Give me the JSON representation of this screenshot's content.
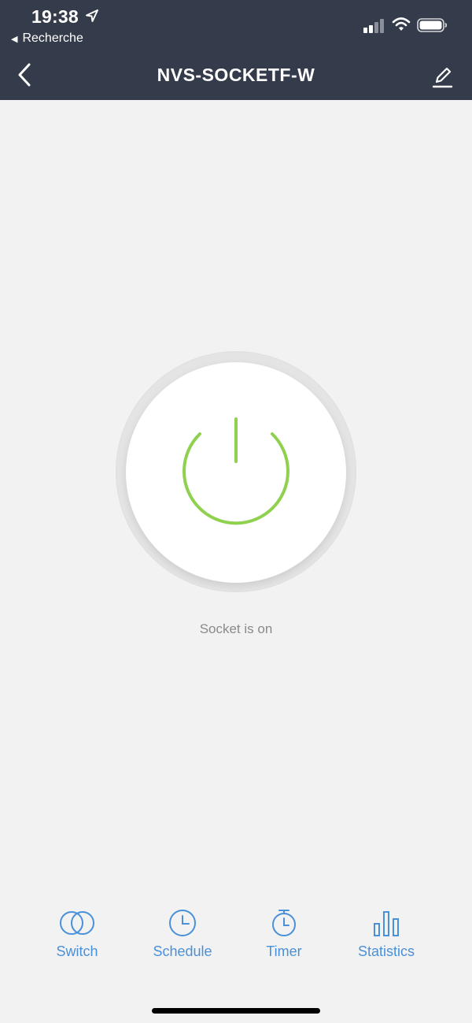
{
  "status_bar": {
    "time": "19:38",
    "back_app_label": "Recherche"
  },
  "nav": {
    "title": "NVS-SOCKETF-W"
  },
  "power": {
    "state": "on",
    "status_text": "Socket is on",
    "accent_color": "#8fd14f"
  },
  "tabs": [
    {
      "label": "Switch",
      "icon": "switch-icon"
    },
    {
      "label": "Schedule",
      "icon": "clock-icon"
    },
    {
      "label": "Timer",
      "icon": "stopwatch-icon"
    },
    {
      "label": "Statistics",
      "icon": "bar-chart-icon"
    }
  ],
  "colors": {
    "header_bg": "#343b4a",
    "tab_accent": "#4a90d9",
    "background": "#f2f2f2"
  }
}
